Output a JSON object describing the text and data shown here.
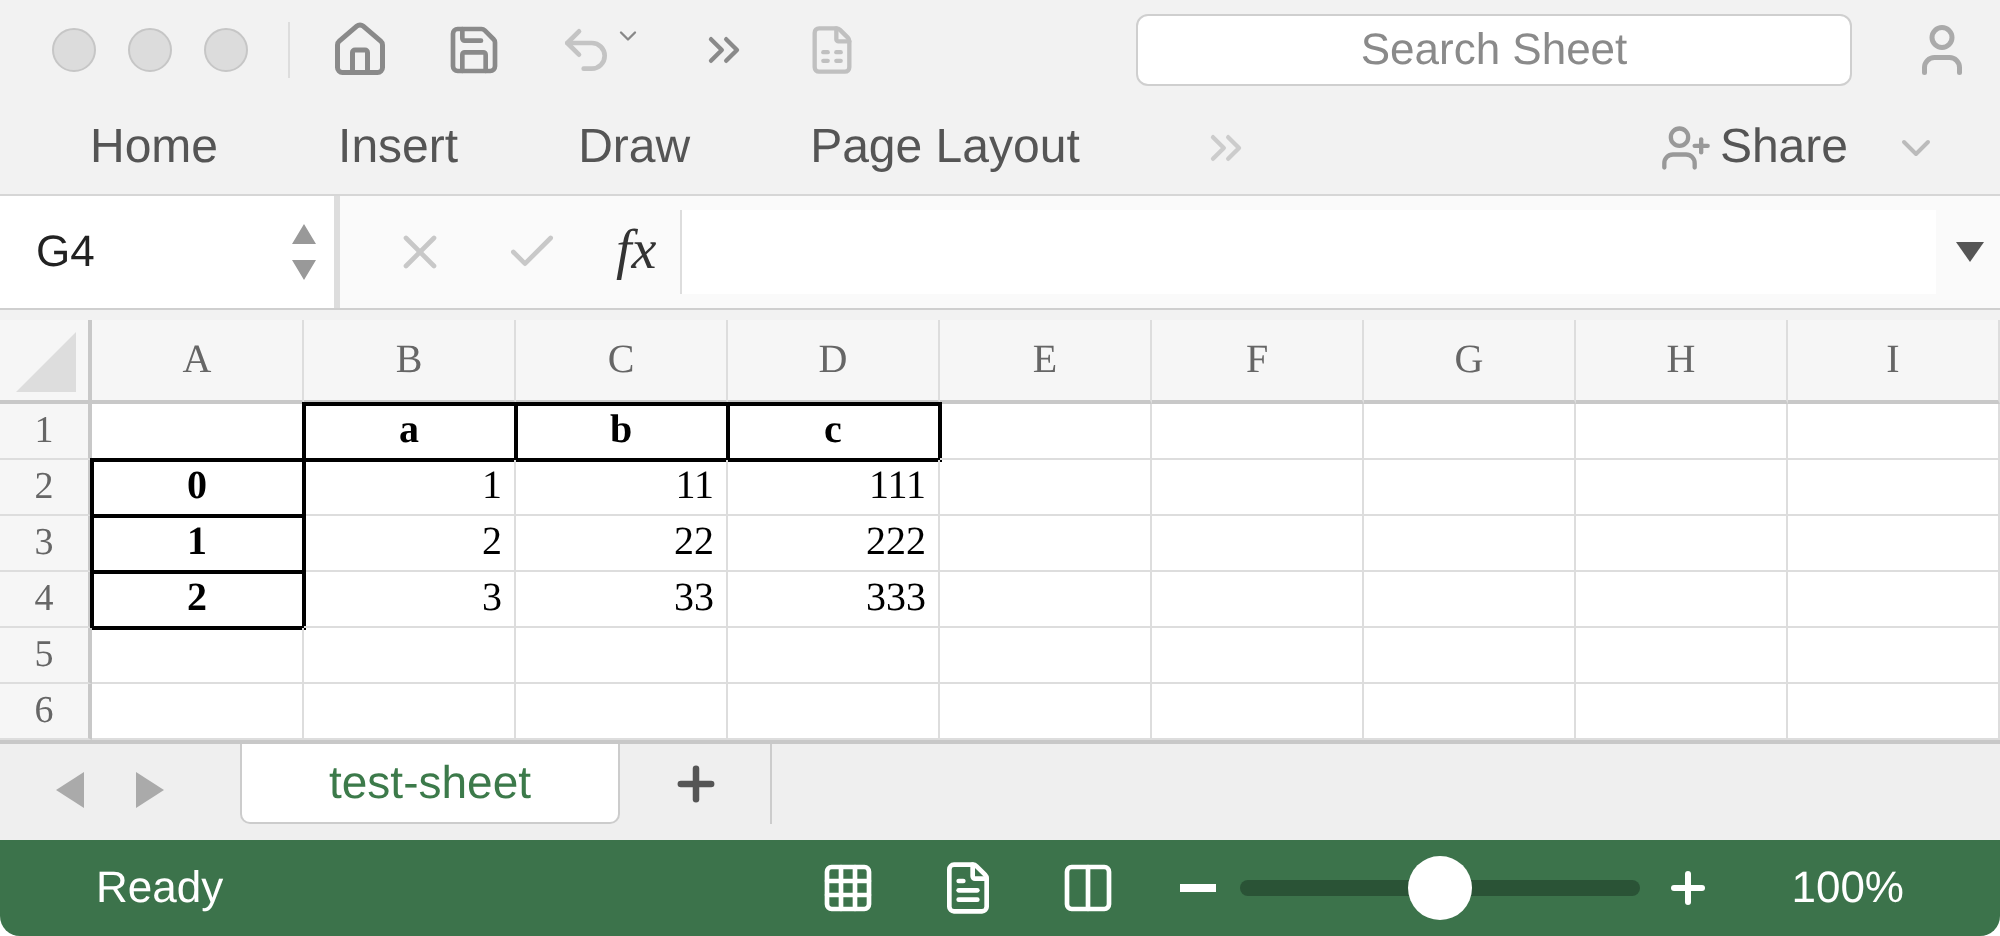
{
  "toolbar": {
    "search": {
      "placeholder": "Search Sheet"
    }
  },
  "ribbon": {
    "tabs": [
      {
        "label": "Home"
      },
      {
        "label": "Insert"
      },
      {
        "label": "Draw"
      },
      {
        "label": "Page Layout"
      }
    ],
    "share": "Share"
  },
  "formula_bar": {
    "name_box": "G4",
    "fx": "fx"
  },
  "sheet": {
    "columns": [
      "A",
      "B",
      "C",
      "D",
      "E",
      "F",
      "G",
      "H",
      "I"
    ],
    "rows": [
      {
        "number": "1",
        "cells": [
          null,
          {
            "text": "a",
            "bold": true,
            "border": true
          },
          {
            "text": "b",
            "bold": true,
            "border": true
          },
          {
            "text": "c",
            "bold": true,
            "border": true
          }
        ]
      },
      {
        "number": "2",
        "cells": [
          {
            "text": "0",
            "bold": true,
            "border": true
          },
          {
            "text": "1",
            "bold": false,
            "border": false
          },
          {
            "text": "11",
            "bold": false,
            "border": false
          },
          {
            "text": "111",
            "bold": false,
            "border": false
          }
        ]
      },
      {
        "number": "3",
        "cells": [
          {
            "text": "1",
            "bold": true,
            "border": true
          },
          {
            "text": "2",
            "bold": false,
            "border": false
          },
          {
            "text": "22",
            "bold": false,
            "border": false
          },
          {
            "text": "222",
            "bold": false,
            "border": false
          }
        ]
      },
      {
        "number": "4",
        "cells": [
          {
            "text": "2",
            "bold": true,
            "border": true
          },
          {
            "text": "3",
            "bold": false,
            "border": false
          },
          {
            "text": "33",
            "bold": false,
            "border": false
          },
          {
            "text": "333",
            "bold": false,
            "border": false
          }
        ]
      },
      {
        "number": "5",
        "cells": []
      },
      {
        "number": "6",
        "cells": []
      }
    ]
  },
  "sheet_tabs": [
    {
      "label": "test-sheet",
      "selected": true
    }
  ],
  "status_bar": {
    "status": "Ready",
    "zoom": {
      "level": 0.5
    },
    "zoom_reading": "100%"
  }
}
